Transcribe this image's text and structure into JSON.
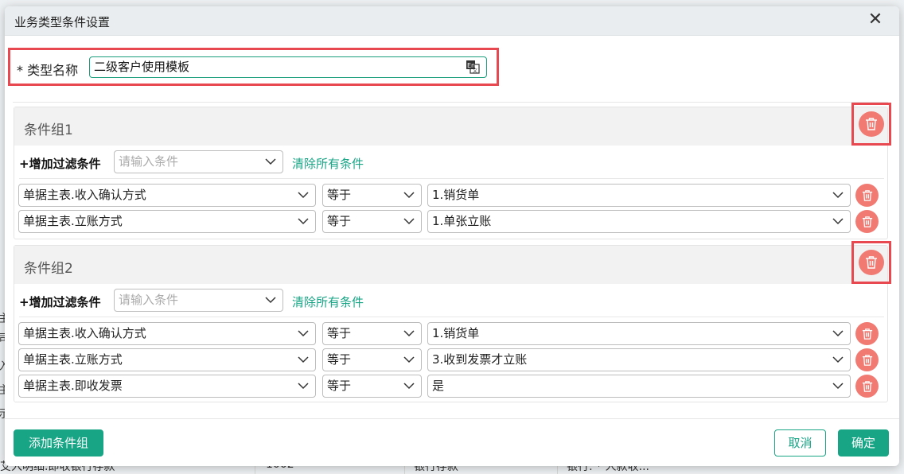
{
  "background": {
    "left_glyphs": [
      "主",
      "司",
      "入",
      "主",
      "示"
    ],
    "row_cells": [
      "艾入明细.即收银行存款",
      "1002",
      "银行存款",
      "银行: * 人款收..."
    ]
  },
  "dialog": {
    "title": "业务类型条件设置",
    "close": "✕",
    "type_name_label": "* 类型名称",
    "type_name_value": "二级客户使用模板",
    "add_filter_label": "+增加过滤条件",
    "condition_placeholder": "请输入条件",
    "clear_all_label": "清除所有条件",
    "groups": [
      {
        "title": "条件组1",
        "rows": [
          {
            "field": "单据主表.收入确认方式",
            "operator": "等于",
            "value": "1.销货单"
          },
          {
            "field": "单据主表.立账方式",
            "operator": "等于",
            "value": "1.单张立账"
          }
        ]
      },
      {
        "title": "条件组2",
        "rows": [
          {
            "field": "单据主表.收入确认方式",
            "operator": "等于",
            "value": "1.销货单"
          },
          {
            "field": "单据主表.立账方式",
            "operator": "等于",
            "value": "3.收到发票才立账"
          },
          {
            "field": "单据主表.即收发票",
            "operator": "等于",
            "value": "是"
          }
        ]
      }
    ],
    "add_group_button": "添加条件组",
    "cancel_button": "取消",
    "confirm_button": "确定"
  },
  "colors": {
    "primary": "#17a585",
    "danger": "#f17b73",
    "highlight_frame": "#e8484f"
  }
}
